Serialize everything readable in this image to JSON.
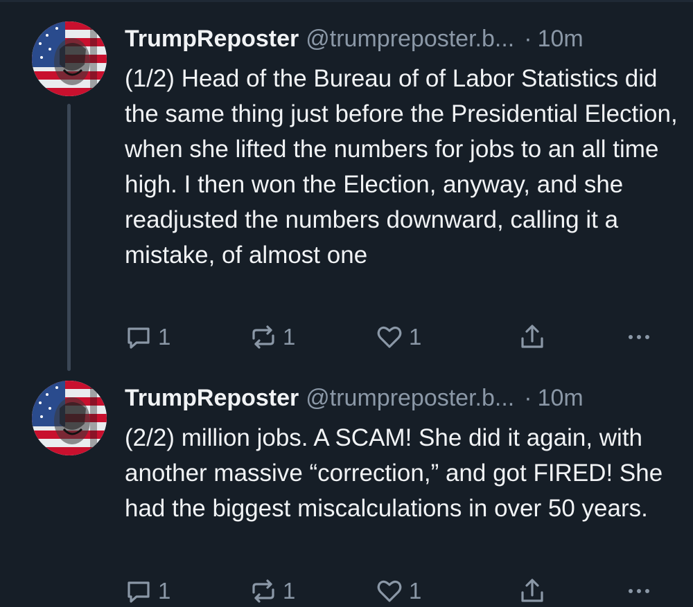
{
  "posts": [
    {
      "author": {
        "display_name": "TrumpReposter",
        "handle": "@trumpreposter.b...",
        "time": "10m",
        "avatar_icon": "avatar-flag-portrait"
      },
      "text": "(1/2) Head of the Bureau of of Labor Statistics did the same thing just before the Presidential Election, when she lifted the numbers for jobs to an all time high. I then won the Election, anyway, and she readjusted the numbers downward, calling it a mistake, of almost one",
      "reply_count": "1",
      "repost_count": "1",
      "like_count": "1"
    },
    {
      "author": {
        "display_name": "TrumpReposter",
        "handle": "@trumpreposter.b...",
        "time": "10m",
        "avatar_icon": "avatar-flag-portrait"
      },
      "text": "(2/2) million jobs. A SCAM! She did it again, with another massive “correction,” and got FIRED! She had the biggest miscalculations in over 50 years.",
      "reply_count": "1",
      "repost_count": "1",
      "like_count": "1"
    }
  ],
  "separator": "·",
  "icons": {
    "reply": "reply-icon",
    "repost": "repost-icon",
    "like": "heart-icon",
    "share": "share-icon",
    "more": "more-icon"
  },
  "colors": {
    "background": "#161e27",
    "text": "#f1f3f5",
    "muted": "#8b98a7",
    "thread_line": "#3b4756"
  }
}
